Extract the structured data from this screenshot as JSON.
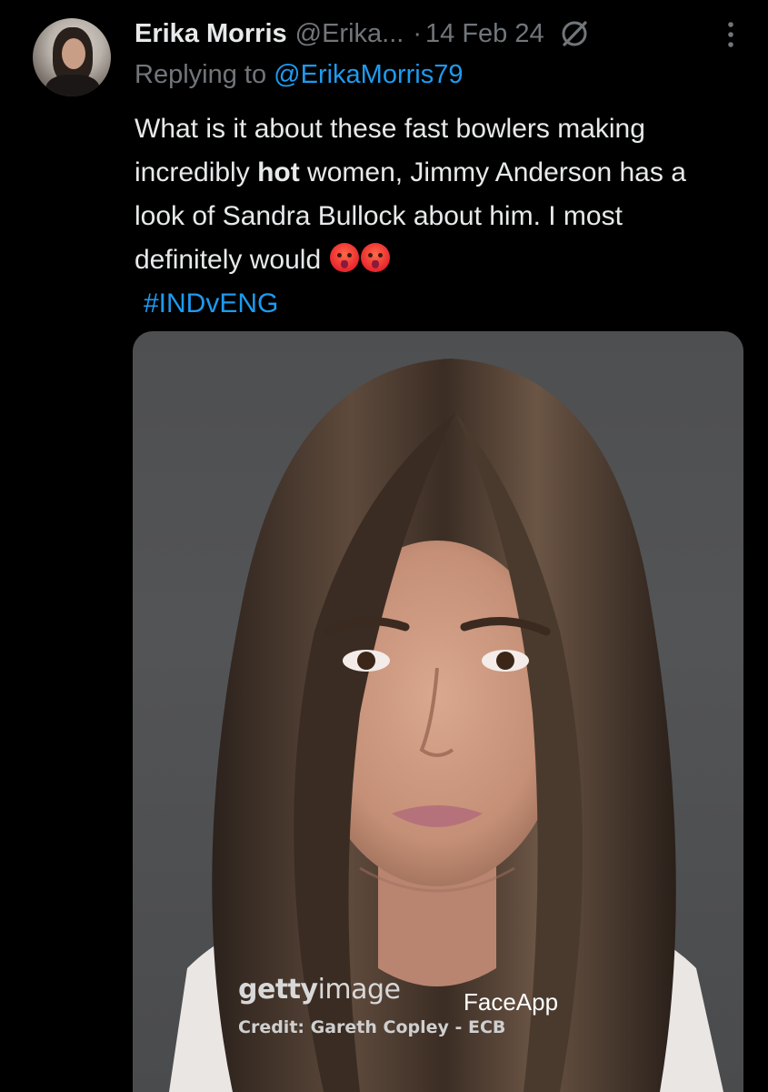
{
  "tweet": {
    "author_name": "Erika Morris",
    "author_handle": "@Erika...",
    "separator": "·",
    "date": "14 Feb 24",
    "reply_prefix": "Replying to",
    "reply_mention": "@ErikaMorris79",
    "text_part1": "What is it about these fast bowlers making incredibly ",
    "text_bold": "hot",
    "text_part2": " women, Jimmy Anderson has a look of Sandra Bullock about him. I most definitely would ",
    "emojis": [
      "hot-face-emoji",
      "hot-face-emoji"
    ],
    "hashtag": "#INDvENG"
  },
  "media": {
    "watermark_brand": "getty",
    "watermark_brand_rest": "image",
    "watermark_credit": "Credit: Gareth Copley - ECB",
    "app_watermark": "FaceApp"
  },
  "icons": {
    "grok": "grok-icon",
    "more": "more-vertical-icon"
  },
  "colors": {
    "background": "#000000",
    "text": "#e7e9ea",
    "muted": "#71767b",
    "link": "#1d9bf0"
  }
}
